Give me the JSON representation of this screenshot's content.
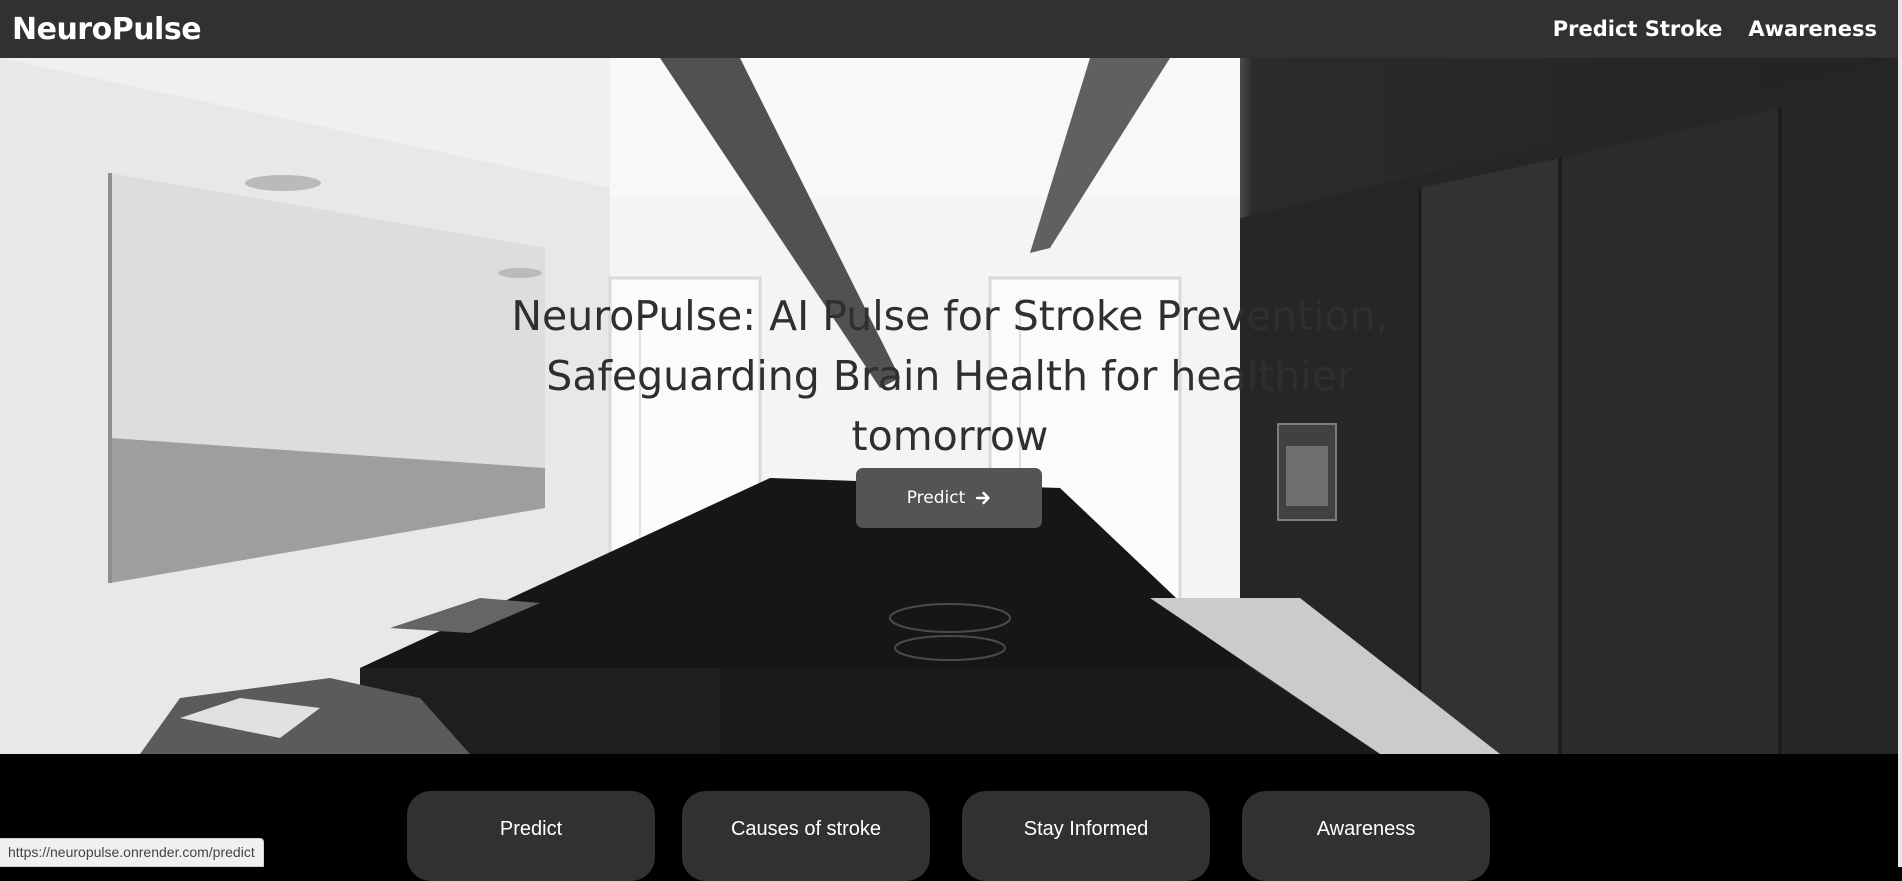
{
  "navbar": {
    "brand": "NeuroPulse",
    "links": [
      "Predict Stroke",
      "Awareness"
    ]
  },
  "hero": {
    "title": "NeuroPulse: AI Pulse for Stroke Prevention, Safeguarding Brain Health for healthier tomorrow",
    "button_label": "Predict",
    "button_icon": "arrow-right-icon"
  },
  "cards": [
    "Predict",
    "Causes of stroke",
    "Stay Informed",
    "Awareness"
  ],
  "status_bar": {
    "url": "https://neuropulse.onrender.com/predict"
  },
  "colors": {
    "navbar_bg": "#323130",
    "card_bg": "#323130",
    "button_bg": "#545454",
    "footer_bg": "#000000"
  }
}
